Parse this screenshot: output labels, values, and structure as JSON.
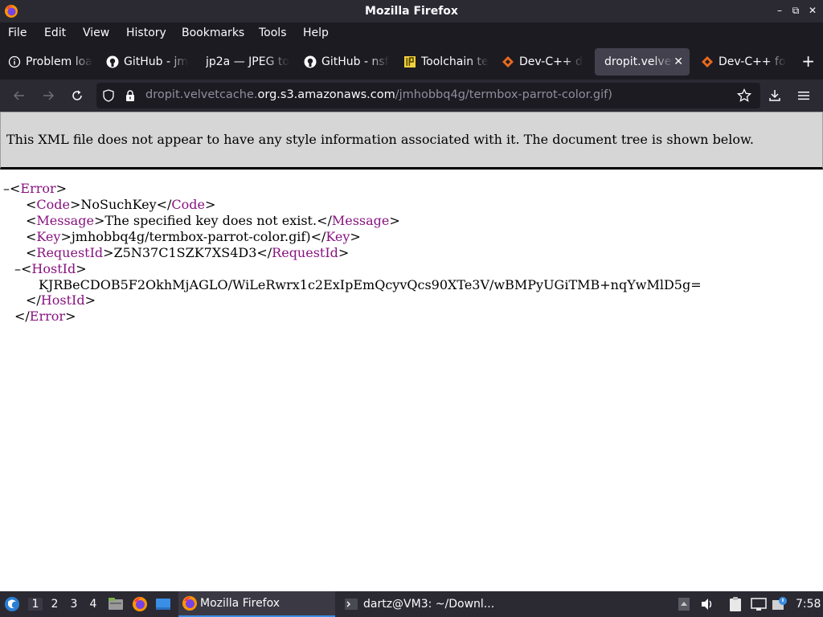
{
  "window": {
    "title": "Mozilla Firefox",
    "controls": [
      "minimize-icon",
      "restore-icon",
      "close-icon"
    ]
  },
  "menu": [
    "File",
    "Edit",
    "View",
    "History",
    "Bookmarks",
    "Tools",
    "Help"
  ],
  "tabs": [
    {
      "label": "Problem loa",
      "icon": "info-icon",
      "active": false
    },
    {
      "label": "GitHub - jm",
      "icon": "github-icon",
      "active": false
    },
    {
      "label": "jp2a — JPEG to",
      "icon": "",
      "active": false
    },
    {
      "label": "GitHub - nsf",
      "icon": "github-icon",
      "active": false
    },
    {
      "label": "Toolchain te",
      "icon": "ip-icon",
      "active": false
    },
    {
      "label": "Dev-C++ d",
      "icon": "devcpp-icon",
      "active": false
    },
    {
      "label": "dropit.velvetc",
      "icon": "",
      "active": true
    },
    {
      "label": "Dev-C++ fo",
      "icon": "devcpp-icon",
      "active": false
    }
  ],
  "url": {
    "prefix": "dropit.velvetcache.",
    "domain": "org.s3.amazonaws.com",
    "path": "/jmhobbq4g/termbox-parrot-color.gif)"
  },
  "xml_notice": "This XML file does not appear to have any style information associated with it. The document tree is shown below.",
  "xml": {
    "root_tag": "Error",
    "code_tag": "Code",
    "code": "NoSuchKey",
    "message_tag": "Message",
    "message": "The specified key does not exist.",
    "key_tag": "Key",
    "key": "jmhobbq4g/termbox-parrot-color.gif)",
    "request_tag": "RequestId",
    "request_id": "Z5N37C1SZK7XS4D3",
    "host_tag": "HostId",
    "host_id": "KJRBeCDOB5F2OkhMjAGLO/WiLeRwrx1c2ExIpEmQcyvQcs90XTe3V/wBMPyUGiTMB+nqYwMlD5g="
  },
  "taskbar": {
    "workspaces": [
      "1",
      "2",
      "3",
      "4"
    ],
    "active_workspace": "1",
    "tasks": [
      {
        "label": "Mozilla Firefox",
        "icon": "firefox-icon",
        "active": true
      },
      {
        "label": "dartz@VM3: ~/Downl...",
        "icon": "terminal-icon",
        "active": false
      }
    ],
    "clock": "7:58"
  },
  "colors": {
    "tag": "#881280",
    "chrome_dark": "#1c1b22",
    "chrome_mid": "#2b2a33",
    "active_tab": "#42414d"
  }
}
